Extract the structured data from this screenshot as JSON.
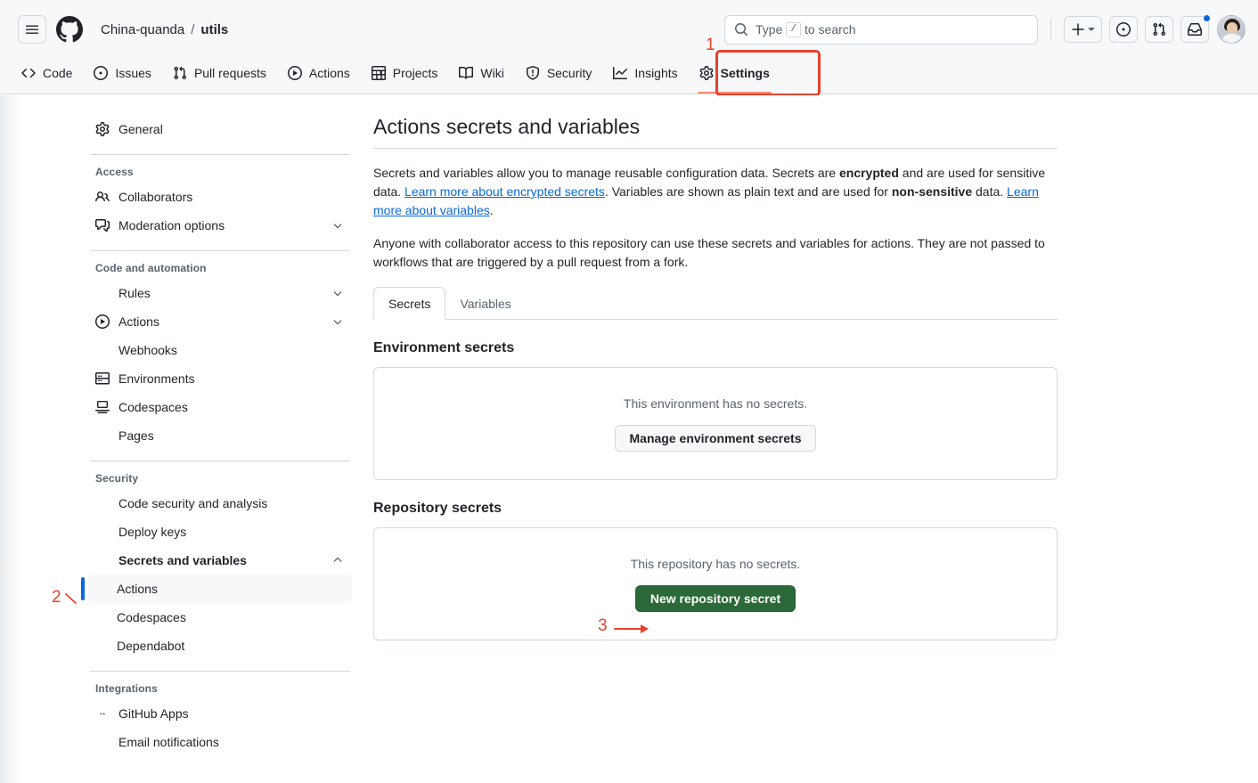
{
  "header": {
    "menu_icon": "hamburger-icon",
    "logo_icon": "github-logo-icon",
    "owner": "China-quanda",
    "separator": "/",
    "repo": "utils",
    "search": {
      "icon": "search-icon",
      "placeholder_prefix": "Type",
      "placeholder_key": "/",
      "placeholder_suffix": "to search"
    },
    "actions": [
      {
        "name": "create-new-button",
        "icon": "plus-icon",
        "has_caret": true
      },
      {
        "name": "issues-button",
        "icon": "issue-opened-icon"
      },
      {
        "name": "pull-requests-button",
        "icon": "git-pull-request-icon"
      },
      {
        "name": "notifications-button",
        "icon": "inbox-icon",
        "has_badge": true
      }
    ],
    "avatar_alt": "user-avatar"
  },
  "nav": {
    "tabs": [
      {
        "label": "Code",
        "icon": "code-icon",
        "active": false
      },
      {
        "label": "Issues",
        "icon": "issue-opened-icon",
        "active": false
      },
      {
        "label": "Pull requests",
        "icon": "git-pull-request-icon",
        "active": false
      },
      {
        "label": "Actions",
        "icon": "play-icon",
        "active": false
      },
      {
        "label": "Projects",
        "icon": "table-icon",
        "active": false
      },
      {
        "label": "Wiki",
        "icon": "book-icon",
        "active": false
      },
      {
        "label": "Security",
        "icon": "shield-icon",
        "active": false
      },
      {
        "label": "Insights",
        "icon": "graph-icon",
        "active": false
      },
      {
        "label": "Settings",
        "icon": "gear-icon",
        "active": true
      }
    ]
  },
  "annotations": [
    {
      "id": "1",
      "label": "1",
      "target": "settings-tab",
      "color": "#e8422b"
    },
    {
      "id": "2",
      "label": "2",
      "target": "sidebar-item-actions-secrets",
      "color": "#e8422b"
    },
    {
      "id": "3",
      "label": "3",
      "target": "new-repository-secret-button",
      "color": "#e8422b"
    }
  ],
  "sidebar": {
    "general": {
      "label": "General",
      "icon": "gear-icon"
    },
    "groups": [
      {
        "heading": "Access",
        "items": [
          {
            "label": "Collaborators",
            "icon": "people-icon",
            "expandable": false
          },
          {
            "label": "Moderation options",
            "icon": "comment-discussion-icon",
            "expandable": true,
            "expanded": false
          }
        ]
      },
      {
        "heading": "Code and automation",
        "items": [
          {
            "label": "Rules",
            "icon": "rules-icon",
            "expandable": true,
            "expanded": false
          },
          {
            "label": "Actions",
            "icon": "play-icon",
            "expandable": true,
            "expanded": false
          },
          {
            "label": "Webhooks",
            "icon": "webhook-icon",
            "expandable": false
          },
          {
            "label": "Environments",
            "icon": "server-icon",
            "expandable": false
          },
          {
            "label": "Codespaces",
            "icon": "codespaces-icon",
            "expandable": false
          },
          {
            "label": "Pages",
            "icon": "browser-icon",
            "expandable": false
          }
        ]
      },
      {
        "heading": "Security",
        "items": [
          {
            "label": "Code security and analysis",
            "icon": "codescan-icon",
            "expandable": false
          },
          {
            "label": "Deploy keys",
            "icon": "key-icon",
            "expandable": false
          },
          {
            "label": "Secrets and variables",
            "icon": "asterisk-key-icon",
            "expandable": true,
            "expanded": true,
            "bold": true
          }
        ],
        "subitems": [
          {
            "label": "Actions",
            "active": true
          },
          {
            "label": "Codespaces",
            "active": false
          },
          {
            "label": "Dependabot",
            "active": false
          }
        ]
      },
      {
        "heading": "Integrations",
        "items": [
          {
            "label": "GitHub Apps",
            "icon": "github-app-icon",
            "expandable": false
          },
          {
            "label": "Email notifications",
            "icon": "mail-icon",
            "expandable": false
          }
        ]
      }
    ]
  },
  "main": {
    "title": "Actions secrets and variables",
    "intro": {
      "p1_a": "Secrets and variables allow you to manage reusable configuration data. Secrets are ",
      "p1_b_encrypted": "encrypted",
      "p1_c": " and are used for sensitive data. ",
      "p1_link1": "Learn more about encrypted secrets",
      "p1_d": ". Variables are shown as plain text and are used for ",
      "p1_b_nonsensitive": "non-sensitive",
      "p1_e": " data. ",
      "p1_link2": "Learn more about variables",
      "p1_f": ".",
      "p2": "Anyone with collaborator access to this repository can use these secrets and variables for actions. They are not passed to workflows that are triggered by a pull request from a fork."
    },
    "tabs": [
      {
        "label": "Secrets",
        "active": true
      },
      {
        "label": "Variables",
        "active": false
      }
    ],
    "environment_section": {
      "heading": "Environment secrets",
      "empty_message": "This environment has no secrets.",
      "button_label": "Manage environment secrets"
    },
    "repository_section": {
      "heading": "Repository secrets",
      "empty_message": "This repository has no secrets.",
      "button_label": "New repository secret",
      "button_color": "#2b6a38"
    }
  }
}
